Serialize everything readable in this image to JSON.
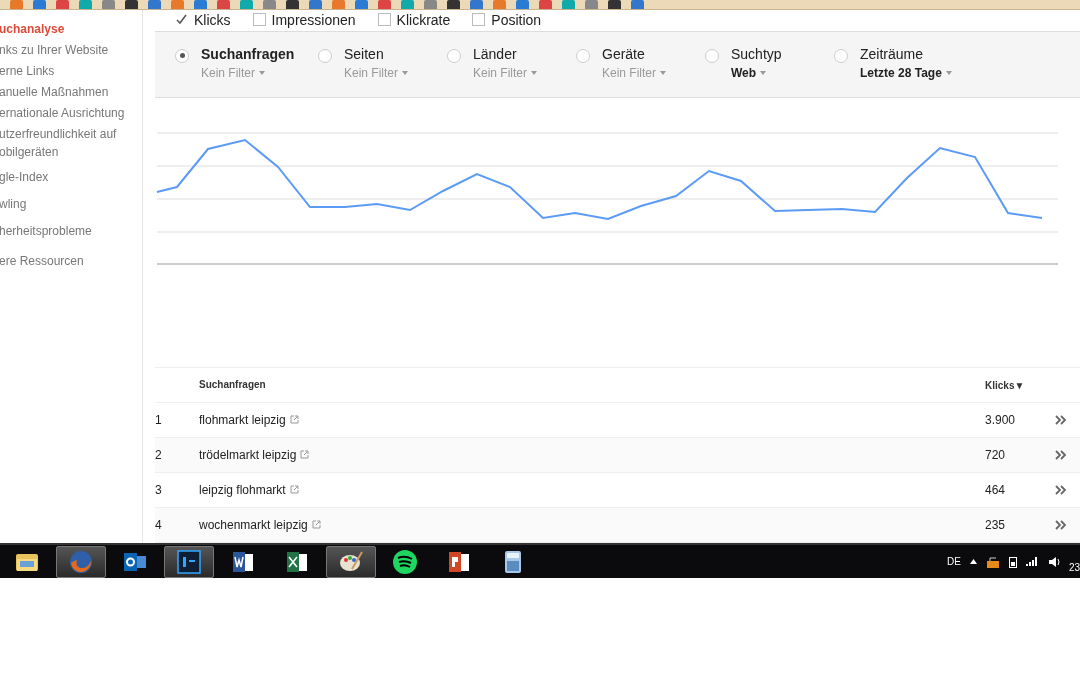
{
  "metrics": [
    {
      "label": "Klicks",
      "checked": true
    },
    {
      "label": "Impressionen",
      "checked": false
    },
    {
      "label": "Klickrate",
      "checked": false
    },
    {
      "label": "Position",
      "checked": false
    }
  ],
  "sidebar": {
    "items": [
      {
        "label": "uchanalyse",
        "selected": true
      },
      {
        "label": "nks zu Ihrer Website",
        "selected": false
      },
      {
        "label": "erne Links",
        "selected": false
      },
      {
        "label": "anuelle Maßnahmen",
        "selected": false
      },
      {
        "label": "ernationale Ausrichtung",
        "selected": false
      },
      {
        "label": "utzerfreundlichkeit auf obilgeräten",
        "selected": false
      },
      {
        "label": "gle-Index",
        "selected": false
      },
      {
        "label": "wling",
        "selected": false
      },
      {
        "label": "herheitsprobleme",
        "selected": false
      },
      {
        "label": "ere Ressourcen",
        "selected": false
      }
    ]
  },
  "filters": [
    {
      "label": "Suchanfragen",
      "selected": true,
      "kind": "filter",
      "value": "Kein Filter"
    },
    {
      "label": "Seiten",
      "selected": false,
      "kind": "filter",
      "value": "Kein Filter"
    },
    {
      "label": "Länder",
      "selected": false,
      "kind": "filter",
      "value": "Kein Filter"
    },
    {
      "label": "Geräte",
      "selected": false,
      "kind": "filter",
      "value": "Kein Filter"
    },
    {
      "label": "Suchtyp",
      "selected": false,
      "kind": "value",
      "value": "Web"
    },
    {
      "label": "Zeiträume",
      "selected": false,
      "kind": "value",
      "value": "Letzte 28 Tage"
    }
  ],
  "table": {
    "columns": [
      "Suchanfragen",
      "Klicks▼"
    ],
    "rows": [
      {
        "rank": "1",
        "query": "flohmarkt leipzig",
        "clicks": "3.900"
      },
      {
        "rank": "2",
        "query": "trödelmarkt leipzig",
        "clicks": "720"
      },
      {
        "rank": "3",
        "query": "leipzig flohmarkt",
        "clicks": "464"
      },
      {
        "rank": "4",
        "query": "wochenmarkt leipzig",
        "clicks": "235"
      }
    ]
  },
  "taskbar": {
    "apps": [
      {
        "kind": "folder",
        "selected": false
      },
      {
        "kind": "firefox",
        "selected": true
      },
      {
        "kind": "outlook",
        "selected": false
      },
      {
        "kind": "photoshop",
        "selected": true
      },
      {
        "kind": "word",
        "selected": false
      },
      {
        "kind": "excel",
        "selected": false
      },
      {
        "kind": "paint",
        "selected": true
      },
      {
        "kind": "spotify",
        "selected": false
      },
      {
        "kind": "powerpoint",
        "selected": false
      },
      {
        "kind": "calculator",
        "selected": false
      }
    ],
    "language": "DE",
    "clock": "23"
  }
}
